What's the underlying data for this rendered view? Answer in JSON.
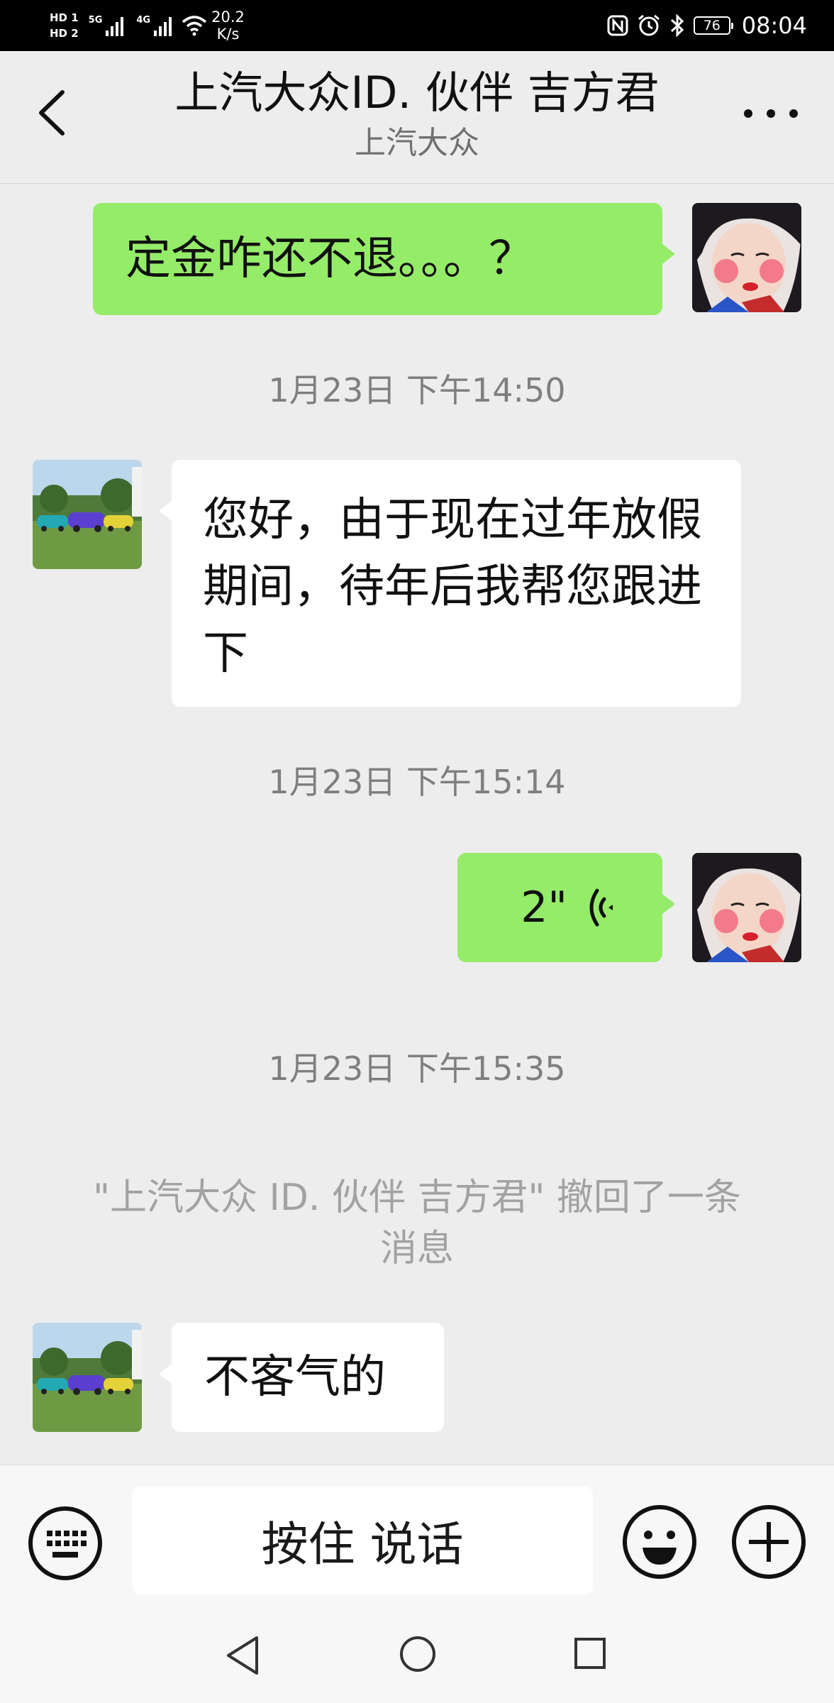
{
  "status_bar": {
    "hd1": "HD 1",
    "hd2": "HD 2",
    "net_5g": "5G",
    "net_4g": "4G",
    "speed_value": "20.2",
    "speed_unit": "K/s",
    "battery": "76",
    "time": "08:04"
  },
  "header": {
    "title": "上汽大众ID. 伙伴 吉方君",
    "subtitle": "上汽大众"
  },
  "messages": {
    "m1_text": "定金咋还不退。。。？",
    "ts1": "1月23日 下午14:50",
    "m2_text": "您好，由于现在过年放假期间，待年后我帮您跟进下",
    "ts2": "1月23日 下午15:14",
    "m3_voice_duration": "2\"",
    "ts3": "1月23日 下午15:35",
    "recall_notice": "\"上汽大众 ID. 伙伴 吉方君\" 撤回了一条消息",
    "m4_text": "不客气的"
  },
  "input_bar": {
    "hold_to_talk": "按住 说话"
  },
  "colors": {
    "my_bubble": "#95ec69",
    "their_bubble": "#ffffff",
    "background": "#ededed"
  }
}
